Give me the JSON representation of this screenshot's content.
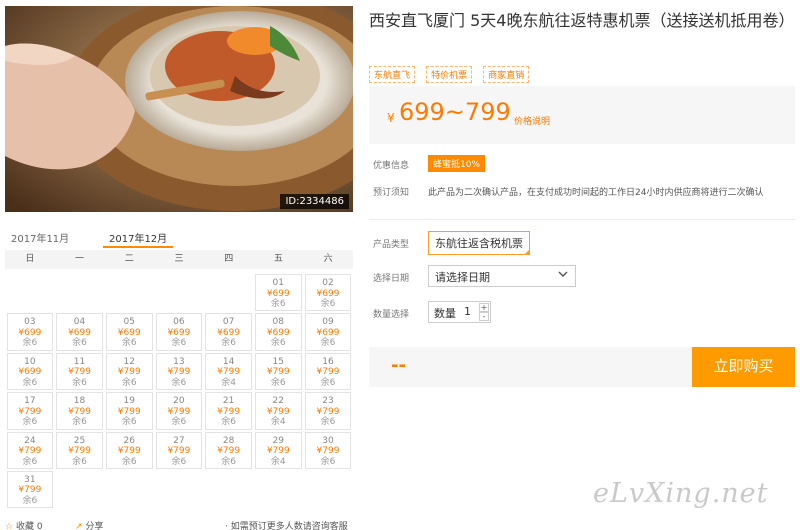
{
  "photo": {
    "id_label": "ID:2334486"
  },
  "months": [
    {
      "label": "2017年11月",
      "active": false
    },
    {
      "label": "2017年12月",
      "active": true
    }
  ],
  "weekdays": [
    "日",
    "一",
    "二",
    "三",
    "四",
    "五",
    "六"
  ],
  "calendar_leading_blanks": 5,
  "calendar_days": [
    {
      "d": "01",
      "p": "¥699",
      "s": "余6"
    },
    {
      "d": "02",
      "p": "¥699",
      "s": "余6"
    },
    {
      "d": "03",
      "p": "¥699",
      "s": "余6"
    },
    {
      "d": "04",
      "p": "¥699",
      "s": "余6"
    },
    {
      "d": "05",
      "p": "¥699",
      "s": "余6"
    },
    {
      "d": "06",
      "p": "¥699",
      "s": "余6"
    },
    {
      "d": "07",
      "p": "¥699",
      "s": "余6"
    },
    {
      "d": "08",
      "p": "¥699",
      "s": "余6"
    },
    {
      "d": "09",
      "p": "¥699",
      "s": "余6"
    },
    {
      "d": "10",
      "p": "¥699",
      "s": "余6"
    },
    {
      "d": "11",
      "p": "¥799",
      "s": "余6"
    },
    {
      "d": "12",
      "p": "¥799",
      "s": "余6"
    },
    {
      "d": "13",
      "p": "¥799",
      "s": "余6"
    },
    {
      "d": "14",
      "p": "¥799",
      "s": "余4"
    },
    {
      "d": "15",
      "p": "¥799",
      "s": "余6"
    },
    {
      "d": "16",
      "p": "¥799",
      "s": "余6"
    },
    {
      "d": "17",
      "p": "¥799",
      "s": "余6"
    },
    {
      "d": "18",
      "p": "¥799",
      "s": "余6"
    },
    {
      "d": "19",
      "p": "¥799",
      "s": "余6"
    },
    {
      "d": "20",
      "p": "¥799",
      "s": "余6"
    },
    {
      "d": "21",
      "p": "¥799",
      "s": "余6"
    },
    {
      "d": "22",
      "p": "¥799",
      "s": "余4"
    },
    {
      "d": "23",
      "p": "¥799",
      "s": "余6"
    },
    {
      "d": "24",
      "p": "¥799",
      "s": "余6"
    },
    {
      "d": "25",
      "p": "¥799",
      "s": "余6"
    },
    {
      "d": "26",
      "p": "¥799",
      "s": "余6"
    },
    {
      "d": "27",
      "p": "¥799",
      "s": "余6"
    },
    {
      "d": "28",
      "p": "¥799",
      "s": "余6"
    },
    {
      "d": "29",
      "p": "¥799",
      "s": "余4"
    },
    {
      "d": "30",
      "p": "¥799",
      "s": "余6"
    },
    {
      "d": "31",
      "p": "¥799",
      "s": "余6"
    }
  ],
  "bottom": {
    "favorite": "收藏 0",
    "share": "分享",
    "consult": "· 如需预订更多人数请咨询客服"
  },
  "product": {
    "title": "西安直飞厦门 5天4晚东航往返特惠机票（送接送机抵用卷）",
    "tags": [
      "东航直飞",
      "特价机票",
      "商家直销"
    ]
  },
  "price": {
    "currency": "¥",
    "range": "699~799",
    "note": "价格说明"
  },
  "promo": {
    "label": "优惠信息",
    "badge": "蜂蜜抵10%"
  },
  "notice": {
    "label": "预订须知",
    "text": "此产品为二次确认产品，在支付成功时间起的工作日24小时内供应商将进行二次确认"
  },
  "options": {
    "type_label": "产品类型",
    "type_value": "东航往返含税机票",
    "date_label": "选择日期",
    "date_placeholder": "请选择日期",
    "qty_label": "数量选择",
    "qty_prefix": "数量",
    "qty_value": "1"
  },
  "purchase": {
    "total": "--",
    "button": "立即购买"
  },
  "watermark": "eLvXing.net",
  "colors": {
    "accent": "#ff8a00",
    "price": "#ff7a00"
  }
}
